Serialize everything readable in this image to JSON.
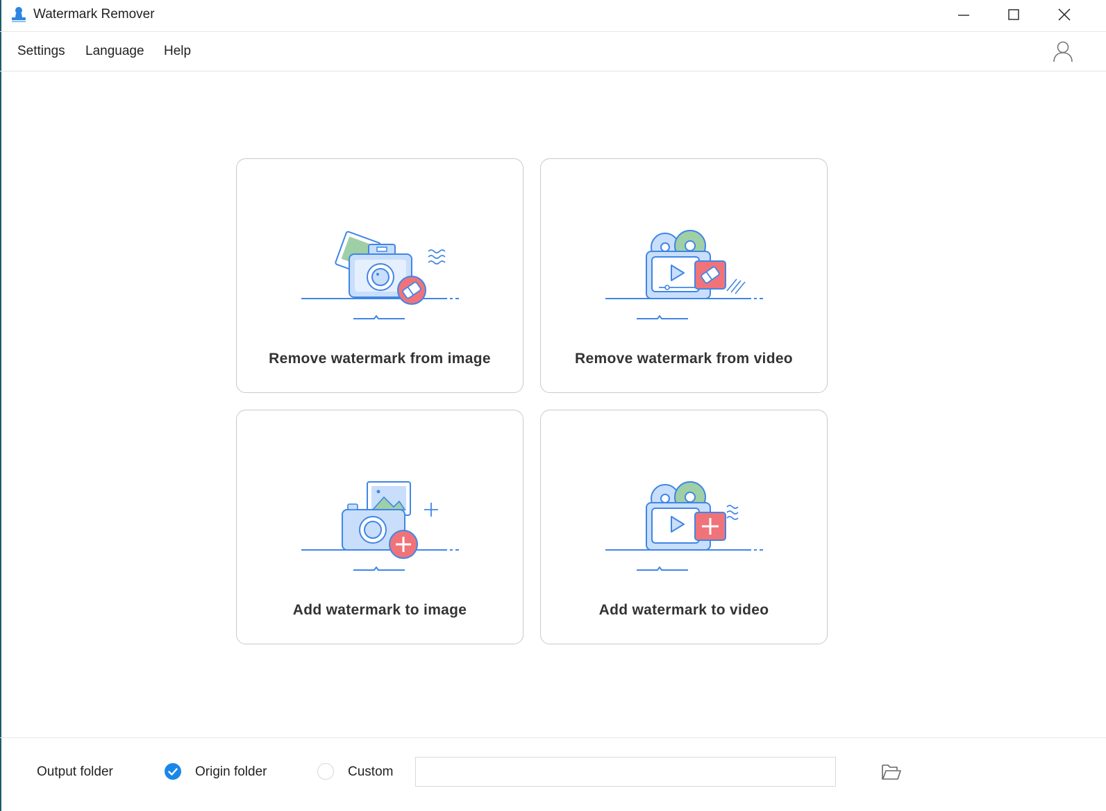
{
  "window": {
    "title": "Watermark Remover",
    "icon": "app-stamp-icon",
    "controls": [
      "minimize-icon",
      "maximize-icon",
      "close-icon"
    ]
  },
  "menu": {
    "items": [
      "Settings",
      "Language",
      "Help"
    ],
    "user_icon": "user-icon"
  },
  "cards": [
    {
      "label": "Remove watermark from image",
      "icon": "camera-eraser-icon"
    },
    {
      "label": "Remove watermark from video",
      "icon": "video-eraser-icon"
    },
    {
      "label": "Add watermark to image",
      "icon": "camera-plus-icon"
    },
    {
      "label": "Add watermark to video",
      "icon": "video-plus-icon"
    }
  ],
  "footer": {
    "output_label": "Output folder",
    "origin_label": "Origin folder",
    "custom_label": "Custom",
    "selected": "Origin folder",
    "path_value": "",
    "folder_icon": "folder-open-icon"
  },
  "colors": {
    "accent_blue": "#1a86e8",
    "illus_stroke": "#3f86e6",
    "illus_fill": "#c9defb",
    "illus_red": "#f0737a",
    "illus_green": "#9fcfa6"
  }
}
